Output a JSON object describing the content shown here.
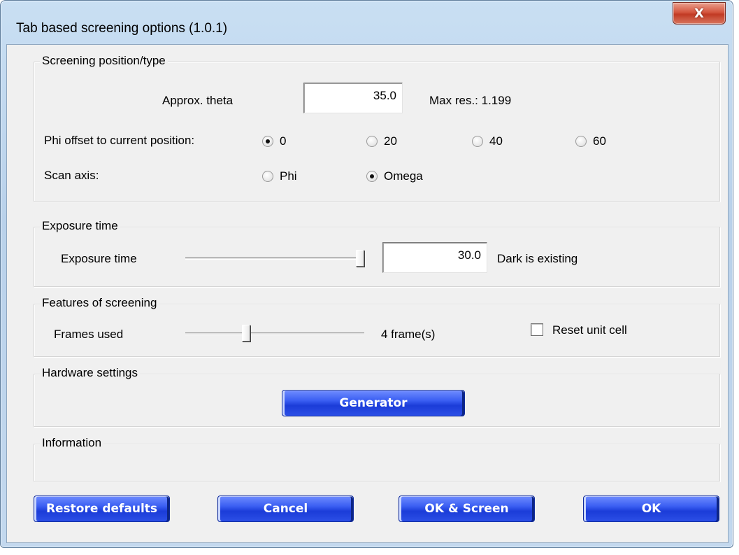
{
  "window": {
    "title": "Tab based screening options (1.0.1)",
    "close_glyph": "X"
  },
  "screening": {
    "title": "Screening position/type",
    "theta_label": "Approx. theta",
    "theta_value": "35.0",
    "max_res": "Max res.: 1.199",
    "phi_label": "Phi offset to current position:",
    "phi_options": [
      "0",
      "20",
      "40",
      "60"
    ],
    "phi_selected": "0",
    "scan_label": "Scan axis:",
    "scan_options": [
      "Phi",
      "Omega"
    ],
    "scan_selected": "Omega"
  },
  "exposure": {
    "title": "Exposure time",
    "label": "Exposure time",
    "value": "30.0",
    "slider_fraction": 1.0,
    "status": "Dark is existing"
  },
  "features": {
    "title": "Features of screening",
    "frames_label": "Frames used",
    "frames_value": "4 frame(s)",
    "slider_fraction": 0.33,
    "reset_label": "Reset unit cell",
    "reset_checked": false
  },
  "hardware": {
    "title": "Hardware settings",
    "generator_label": "Generator"
  },
  "information": {
    "title": "Information"
  },
  "buttons": {
    "restore": "Restore defaults",
    "cancel": "Cancel",
    "ok_screen": "OK & Screen",
    "ok": "OK"
  }
}
